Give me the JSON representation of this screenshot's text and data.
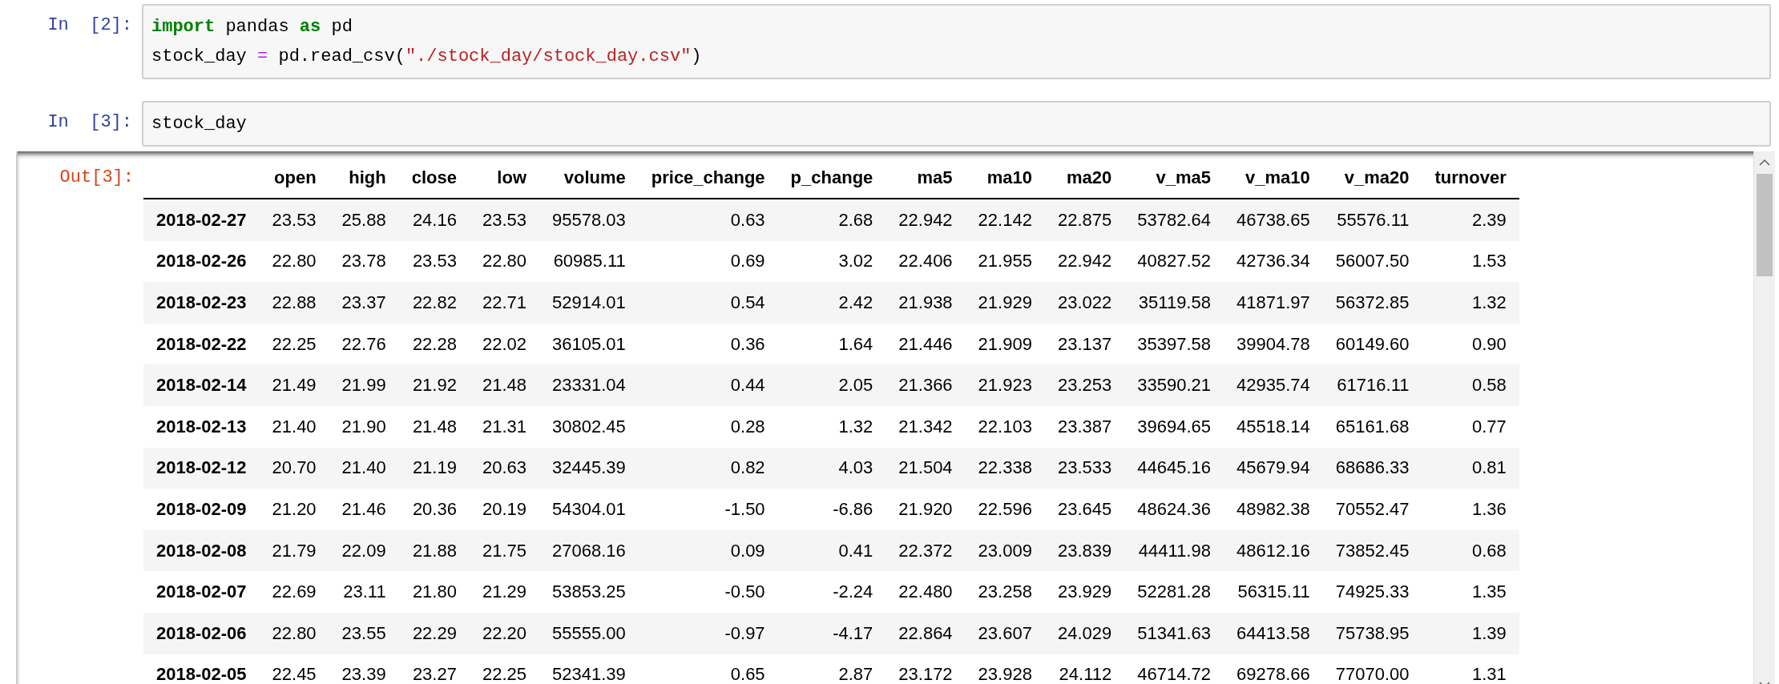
{
  "cells": [
    {
      "kind": "input",
      "prompt": "In  [2]:",
      "lines": [
        [
          {
            "text": "import",
            "kind": "keyword"
          },
          {
            "text": " pandas ",
            "kind": "plain"
          },
          {
            "text": "as",
            "kind": "keyword"
          },
          {
            "text": " pd",
            "kind": "plain"
          }
        ],
        [
          {
            "text": "stock_day ",
            "kind": "plain"
          },
          {
            "text": "=",
            "kind": "operator"
          },
          {
            "text": " pd.read_csv(",
            "kind": "plain"
          },
          {
            "text": "\"./stock_day/stock_day.csv\"",
            "kind": "string"
          },
          {
            "text": ")",
            "kind": "plain"
          }
        ]
      ]
    },
    {
      "kind": "input",
      "prompt": "In  [3]:",
      "lines": [
        [
          {
            "text": "stock_day",
            "kind": "plain"
          }
        ]
      ]
    },
    {
      "kind": "output",
      "prompt": "Out[3]:",
      "table": {
        "columns": [
          "open",
          "high",
          "close",
          "low",
          "volume",
          "price_change",
          "p_change",
          "ma5",
          "ma10",
          "ma20",
          "v_ma5",
          "v_ma10",
          "v_ma20",
          "turnover"
        ],
        "rows": [
          {
            "index": "2018-02-27",
            "values": [
              "23.53",
              "25.88",
              "24.16",
              "23.53",
              "95578.03",
              "0.63",
              "2.68",
              "22.942",
              "22.142",
              "22.875",
              "53782.64",
              "46738.65",
              "55576.11",
              "2.39"
            ]
          },
          {
            "index": "2018-02-26",
            "values": [
              "22.80",
              "23.78",
              "23.53",
              "22.80",
              "60985.11",
              "0.69",
              "3.02",
              "22.406",
              "21.955",
              "22.942",
              "40827.52",
              "42736.34",
              "56007.50",
              "1.53"
            ]
          },
          {
            "index": "2018-02-23",
            "values": [
              "22.88",
              "23.37",
              "22.82",
              "22.71",
              "52914.01",
              "0.54",
              "2.42",
              "21.938",
              "21.929",
              "23.022",
              "35119.58",
              "41871.97",
              "56372.85",
              "1.32"
            ]
          },
          {
            "index": "2018-02-22",
            "values": [
              "22.25",
              "22.76",
              "22.28",
              "22.02",
              "36105.01",
              "0.36",
              "1.64",
              "21.446",
              "21.909",
              "23.137",
              "35397.58",
              "39904.78",
              "60149.60",
              "0.90"
            ]
          },
          {
            "index": "2018-02-14",
            "values": [
              "21.49",
              "21.99",
              "21.92",
              "21.48",
              "23331.04",
              "0.44",
              "2.05",
              "21.366",
              "21.923",
              "23.253",
              "33590.21",
              "42935.74",
              "61716.11",
              "0.58"
            ]
          },
          {
            "index": "2018-02-13",
            "values": [
              "21.40",
              "21.90",
              "21.48",
              "21.31",
              "30802.45",
              "0.28",
              "1.32",
              "21.342",
              "22.103",
              "23.387",
              "39694.65",
              "45518.14",
              "65161.68",
              "0.77"
            ]
          },
          {
            "index": "2018-02-12",
            "values": [
              "20.70",
              "21.40",
              "21.19",
              "20.63",
              "32445.39",
              "0.82",
              "4.03",
              "21.504",
              "22.338",
              "23.533",
              "44645.16",
              "45679.94",
              "68686.33",
              "0.81"
            ]
          },
          {
            "index": "2018-02-09",
            "values": [
              "21.20",
              "21.46",
              "20.36",
              "20.19",
              "54304.01",
              "-1.50",
              "-6.86",
              "21.920",
              "22.596",
              "23.645",
              "48624.36",
              "48982.38",
              "70552.47",
              "1.36"
            ]
          },
          {
            "index": "2018-02-08",
            "values": [
              "21.79",
              "22.09",
              "21.88",
              "21.75",
              "27068.16",
              "0.09",
              "0.41",
              "22.372",
              "23.009",
              "23.839",
              "44411.98",
              "48612.16",
              "73852.45",
              "0.68"
            ]
          },
          {
            "index": "2018-02-07",
            "values": [
              "22.69",
              "23.11",
              "21.80",
              "21.29",
              "53853.25",
              "-0.50",
              "-2.24",
              "22.480",
              "23.258",
              "23.929",
              "52281.28",
              "56315.11",
              "74925.33",
              "1.35"
            ]
          },
          {
            "index": "2018-02-06",
            "values": [
              "22.80",
              "23.55",
              "22.29",
              "22.20",
              "55555.00",
              "-0.97",
              "-4.17",
              "22.864",
              "23.607",
              "24.029",
              "51341.63",
              "64413.58",
              "75738.95",
              "1.39"
            ]
          },
          {
            "index": "2018-02-05",
            "values": [
              "22.45",
              "23.39",
              "23.27",
              "22.25",
              "52341.39",
              "0.65",
              "2.87",
              "23.172",
              "23.928",
              "24.112",
              "46714.72",
              "69278.66",
              "77070.00",
              "1.31"
            ]
          }
        ]
      }
    }
  ]
}
